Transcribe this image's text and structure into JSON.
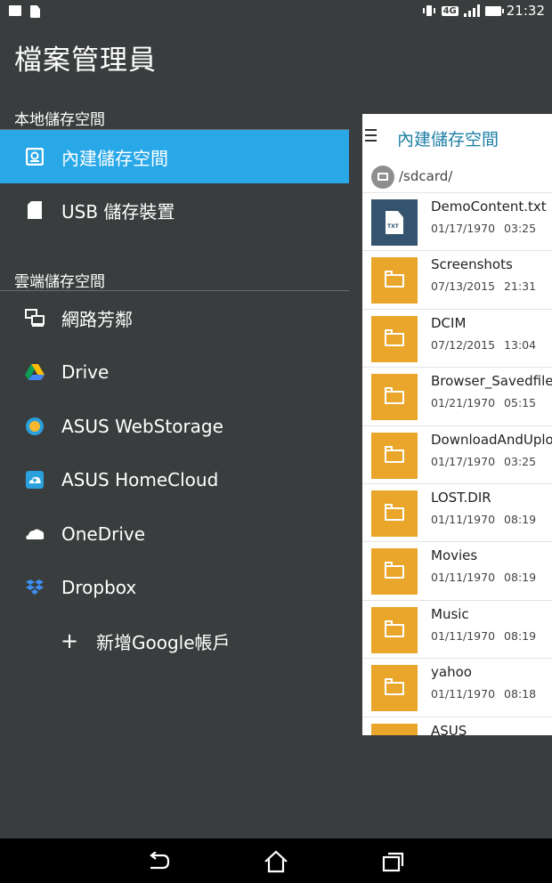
{
  "status_bar": {
    "time": "21:32",
    "network": "4G"
  },
  "app_title": "檔案管理員",
  "sections": {
    "local": "本地儲存空間",
    "cloud": "雲端儲存空間"
  },
  "local_items": [
    {
      "label": "內建儲存空間",
      "icon": "phone-storage-icon",
      "active": true
    },
    {
      "label": "USB 儲存裝置",
      "icon": "sd-card-icon",
      "active": false
    }
  ],
  "cloud_items": [
    {
      "label": "網路芳鄰",
      "icon": "network-neighborhood-icon"
    },
    {
      "label": "Drive",
      "icon": "google-drive-icon"
    },
    {
      "label": "ASUS WebStorage",
      "icon": "asus-webstorage-icon"
    },
    {
      "label": "ASUS HomeCloud",
      "icon": "asus-homecloud-icon"
    },
    {
      "label": "OneDrive",
      "icon": "onedrive-icon"
    },
    {
      "label": "Dropbox",
      "icon": "dropbox-icon"
    }
  ],
  "add_account": {
    "symbol": "+",
    "label": "新增Google帳戶"
  },
  "panel": {
    "title": "內建儲存空間",
    "path": "/sdcard/",
    "files": [
      {
        "name": "DemoContent.txt",
        "date": "01/17/1970",
        "time": "03:25",
        "type": "txt"
      },
      {
        "name": "Screenshots",
        "date": "07/13/2015",
        "time": "21:31",
        "type": "folder"
      },
      {
        "name": "DCIM",
        "date": "07/12/2015",
        "time": "13:04",
        "type": "folder"
      },
      {
        "name": "Browser_Savedfiles",
        "date": "01/21/1970",
        "time": "05:15",
        "type": "folder"
      },
      {
        "name": "DownloadAndUploa",
        "date": "01/17/1970",
        "time": "03:25",
        "type": "folder"
      },
      {
        "name": "LOST.DIR",
        "date": "01/11/1970",
        "time": "08:19",
        "type": "folder"
      },
      {
        "name": "Movies",
        "date": "01/11/1970",
        "time": "08:19",
        "type": "folder"
      },
      {
        "name": "Music",
        "date": "01/11/1970",
        "time": "08:19",
        "type": "folder"
      },
      {
        "name": "yahoo",
        "date": "01/11/1970",
        "time": "08:18",
        "type": "folder"
      },
      {
        "name": "ASUS",
        "date": "",
        "time": "",
        "type": "folder"
      }
    ],
    "txt_badge": "TXT"
  },
  "colors": {
    "accent": "#29a8e8",
    "folder": "#e9a62a",
    "txt": "#34536e",
    "drawer_bg": "#3a3d3e",
    "panel_title": "#1e7fa6"
  }
}
